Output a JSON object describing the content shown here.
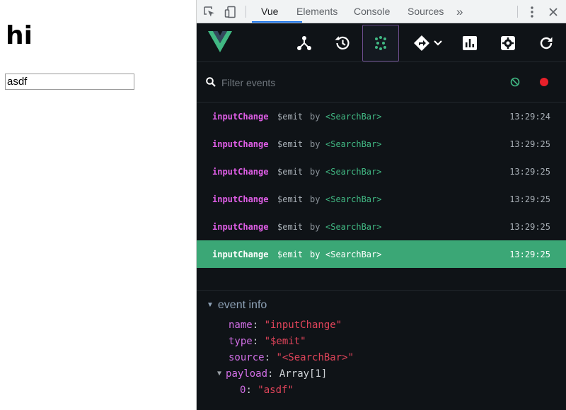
{
  "page": {
    "title": "hi",
    "input_value": "asdf"
  },
  "devtools": {
    "tabs": [
      {
        "label": "Vue",
        "active": true
      },
      {
        "label": "Elements"
      },
      {
        "label": "Console"
      },
      {
        "label": "Sources"
      }
    ],
    "more_tabs": "»",
    "toolbar_icons": [
      "components-icon",
      "timeline-icon",
      "events-icon",
      "router-icon",
      "performance-icon",
      "settings-icon",
      "refresh-icon"
    ],
    "filter": {
      "placeholder": "Filter events"
    },
    "events": [
      {
        "name": "inputChange",
        "type": "$emit",
        "by": "by",
        "component": "<SearchBar>",
        "time": "13:29:24"
      },
      {
        "name": "inputChange",
        "type": "$emit",
        "by": "by",
        "component": "<SearchBar>",
        "time": "13:29:25"
      },
      {
        "name": "inputChange",
        "type": "$emit",
        "by": "by",
        "component": "<SearchBar>",
        "time": "13:29:25"
      },
      {
        "name": "inputChange",
        "type": "$emit",
        "by": "by",
        "component": "<SearchBar>",
        "time": "13:29:25"
      },
      {
        "name": "inputChange",
        "type": "$emit",
        "by": "by",
        "component": "<SearchBar>",
        "time": "13:29:25"
      },
      {
        "name": "inputChange",
        "type": "$emit",
        "by": "by",
        "component": "<SearchBar>",
        "time": "13:29:25",
        "selected": true
      }
    ],
    "inspector": {
      "section_title": "event info",
      "name_key": "name",
      "name_val": "\"inputChange\"",
      "type_key": "type",
      "type_val": "\"$emit\"",
      "source_key": "source",
      "source_val": "\"<SearchBar>\"",
      "payload_key": "payload",
      "payload_val": "Array[1]",
      "item_key": "0",
      "item_val": "\"asdf\""
    }
  },
  "colors": {
    "vue_green": "#41b883",
    "selected_row": "#3ba776",
    "event_name": "#e05ee7",
    "string_value": "#e0445a",
    "record_red": "#e8202a"
  }
}
